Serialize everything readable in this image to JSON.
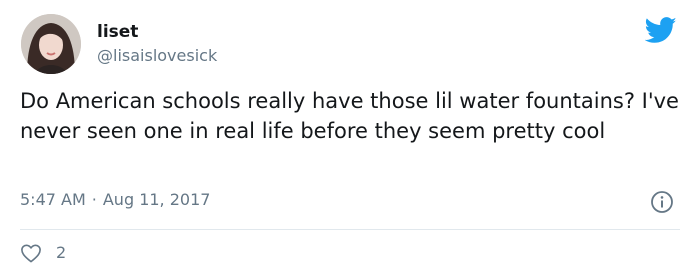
{
  "user": {
    "name": "liset",
    "handle": "@lisaislovesick"
  },
  "tweet": {
    "text": "Do American schools really have those lil water fountains? I've never seen one in real life before they seem pretty cool",
    "time": "5:47 AM",
    "separator": "·",
    "date": "Aug 11, 2017"
  },
  "engagement": {
    "likes": "2"
  },
  "colors": {
    "text": "#14171a",
    "secondary": "#657786",
    "brand": "#1da1f2",
    "divider": "#e1e8ed"
  },
  "icons": {
    "brand": "twitter-bird-icon",
    "info": "info-icon",
    "like": "heart-icon"
  }
}
